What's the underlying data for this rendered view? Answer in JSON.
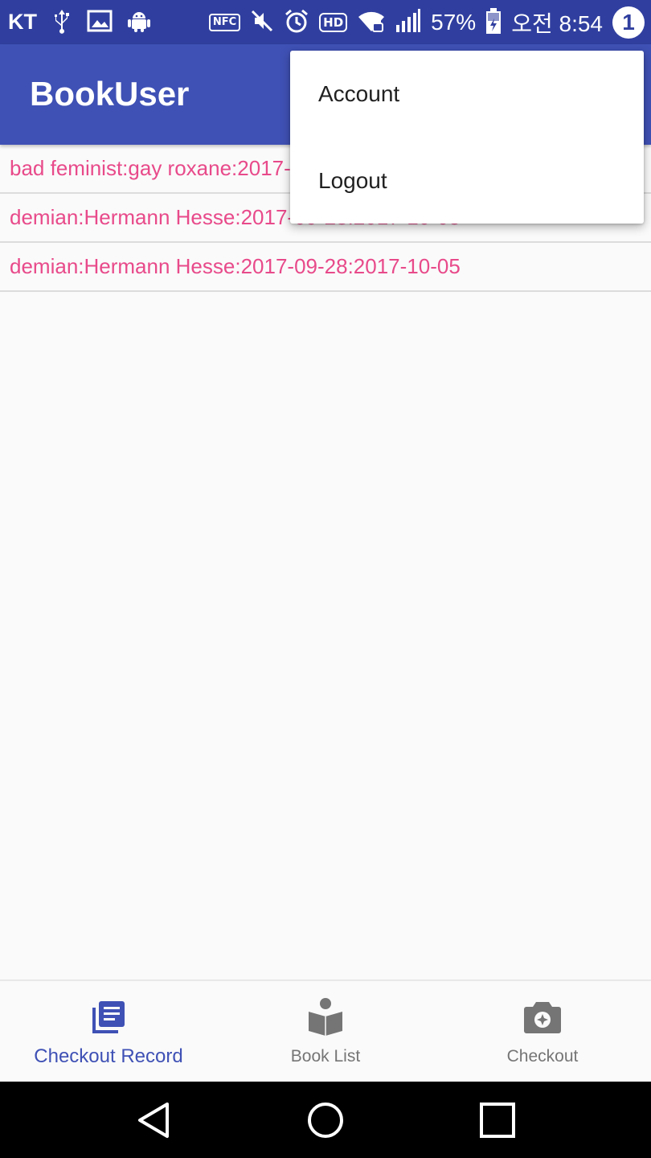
{
  "status_bar": {
    "carrier": "KT",
    "nfc": "NFC",
    "hd": "HD",
    "battery_percent": "57%",
    "time": "오전 8:54",
    "notification_count": "1",
    "icons": [
      "usb-icon",
      "image-icon",
      "android-icon",
      "nfc-icon",
      "mute-icon",
      "alarm-icon",
      "hd-icon",
      "wifi-icon",
      "signal-icon",
      "battery-icon"
    ]
  },
  "app_bar": {
    "title": "BookUser"
  },
  "records": [
    {
      "text": "bad feminist:gay roxane:2017-09-28:2017-10-05"
    },
    {
      "text": "demian:Hermann Hesse:2017-09-28:2017-10-05"
    },
    {
      "text": "demian:Hermann Hesse:2017-09-28:2017-10-05"
    }
  ],
  "overflow_menu": {
    "items": [
      {
        "label": "Account"
      },
      {
        "label": "Logout"
      }
    ]
  },
  "bottom_nav": {
    "items": [
      {
        "label": "Checkout Record",
        "icon": "library-books-icon",
        "active": true
      },
      {
        "label": "Book List",
        "icon": "import-contacts-icon",
        "active": false
      },
      {
        "label": "Checkout",
        "icon": "camera-icon",
        "active": false
      }
    ]
  },
  "colors": {
    "status_bar": "#303f9f",
    "app_bar": "#3f51b5",
    "record_text": "#e84a8a",
    "active_nav": "#3f51b5",
    "inactive_nav": "#757575"
  }
}
